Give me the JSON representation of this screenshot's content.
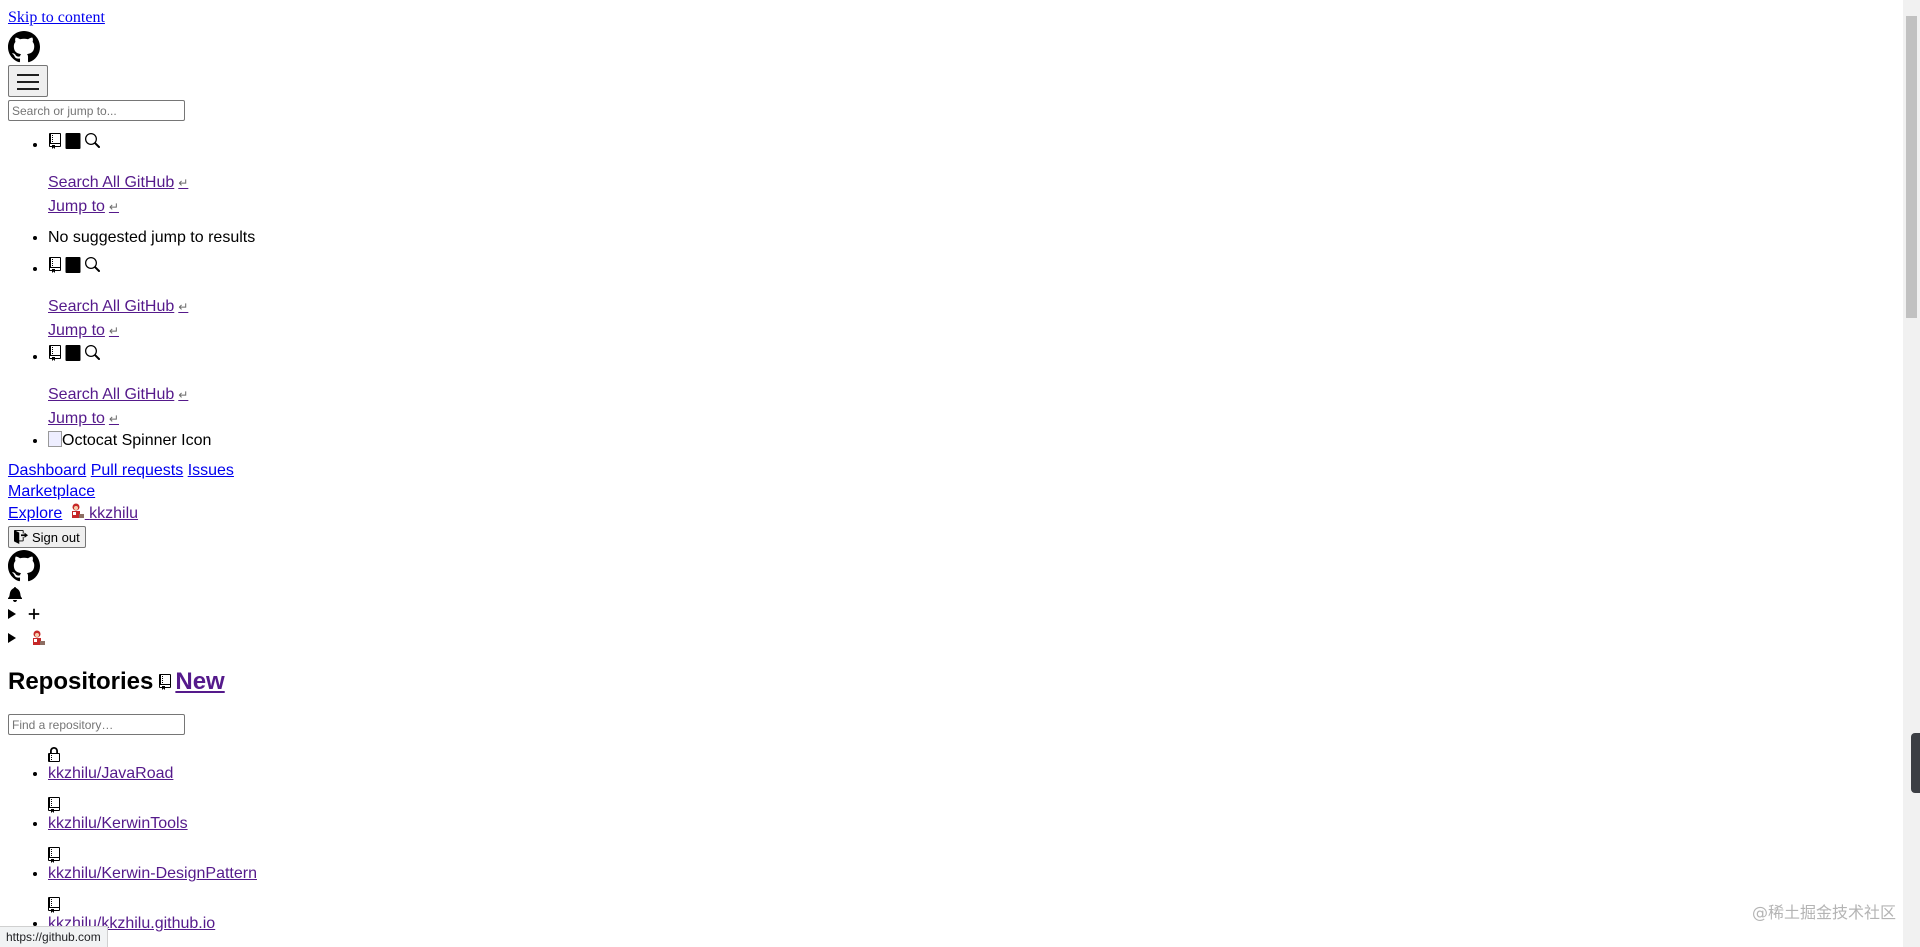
{
  "skip_link": "Skip to content",
  "search": {
    "placeholder": "Search or jump to..."
  },
  "jump_groups": [
    {
      "search_all": "Search All GitHub",
      "jump_to": "Jump to"
    },
    {
      "search_all": "Search All GitHub",
      "jump_to": "Jump to"
    },
    {
      "search_all": "Search All GitHub",
      "jump_to": "Jump to"
    }
  ],
  "enter_symbol": "↵",
  "no_results": "No suggested jump to results",
  "spinner_alt": "Octocat Spinner Icon",
  "nav": {
    "dashboard": "Dashboard",
    "pull_requests": "Pull requests",
    "issues": "Issues",
    "marketplace": "Marketplace",
    "explore": "Explore",
    "username": "kkzhilu"
  },
  "sign_out": "Sign out",
  "repositories": {
    "heading": "Repositories",
    "new_label": "New",
    "find_placeholder": "Find a repository…",
    "items": [
      {
        "name": "kkzhilu/JavaRoad",
        "icon": "lock-icon"
      },
      {
        "name": "kkzhilu/KerwinTools",
        "icon": "repo-icon"
      },
      {
        "name": "kkzhilu/Kerwin-DesignPattern",
        "icon": "repo-icon"
      },
      {
        "name": "kkzhilu/kkzhilu.github.io",
        "icon": "repo-icon"
      }
    ]
  },
  "status_url": "https://github.com",
  "watermark": "@稀土掘金技术社区"
}
